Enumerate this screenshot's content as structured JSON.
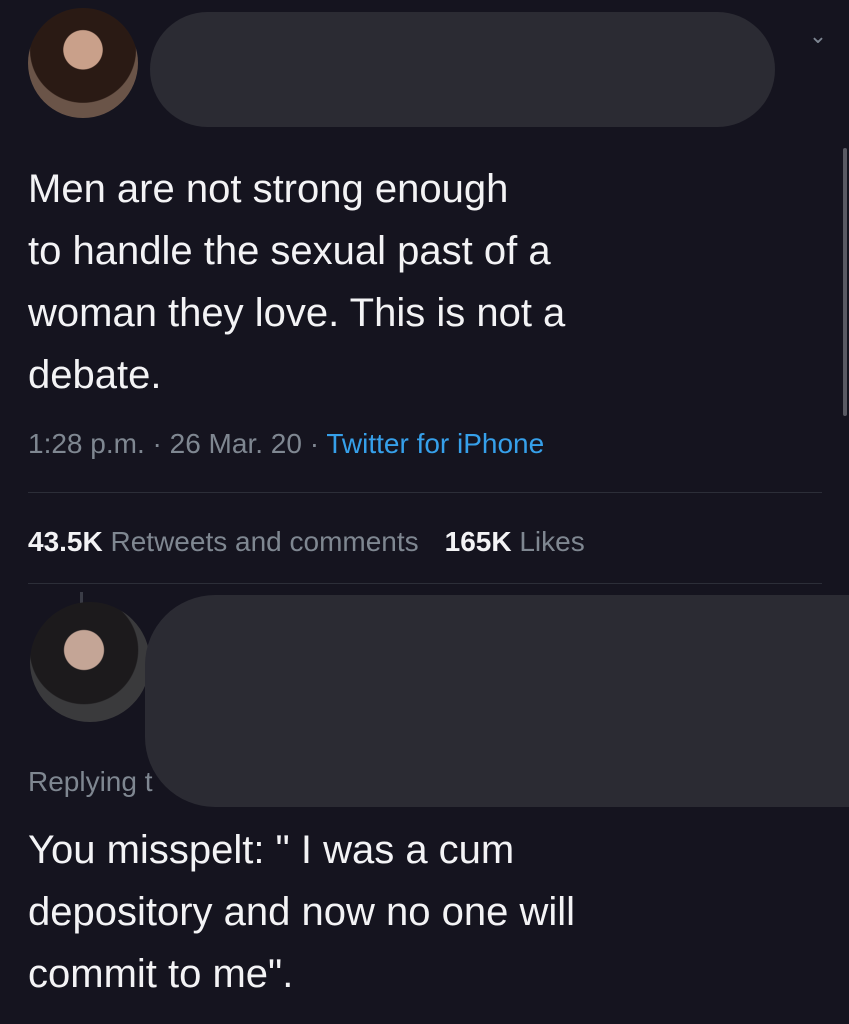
{
  "tweet": {
    "text_lines": [
      "Men are not strong enough",
      "to handle the sexual past of a",
      "woman they love. This is not a",
      "debate."
    ],
    "time": "1:28 p.m.",
    "date": "26 Mar. 20",
    "source": "Twitter for iPhone",
    "separator": "·",
    "retweets_count": "43.5K",
    "retweets_label": "Retweets and comments",
    "likes_count": "165K",
    "likes_label": "Likes"
  },
  "reply": {
    "replying_to": "Replying t",
    "text_lines": [
      "You misspelt: \" I was a cum",
      "depository and now no one will",
      "commit to me\"."
    ]
  },
  "icons": {
    "chevron": "chevron-down-icon"
  },
  "colors": {
    "background": "#15141f",
    "text": "#f3f3f5",
    "muted": "#7f8791",
    "link": "#36a0ea",
    "redaction": "#2b2b33"
  }
}
